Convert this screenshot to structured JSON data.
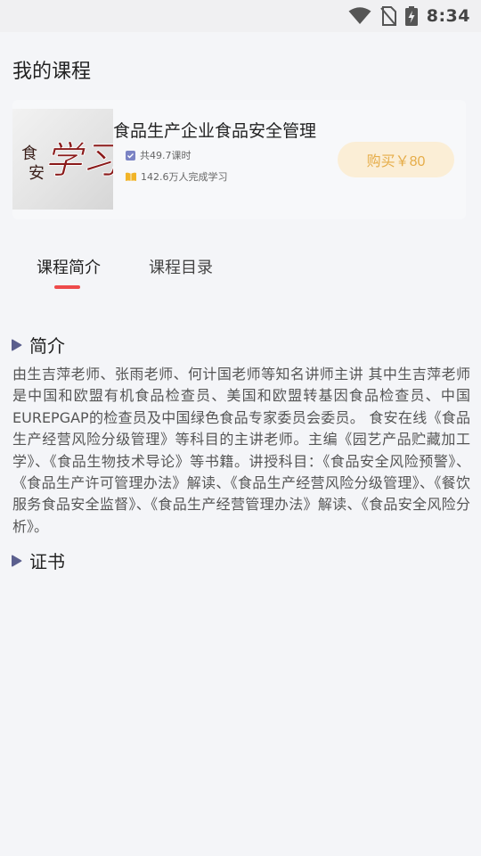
{
  "status_bar": {
    "time": "8:34",
    "icons": [
      "wifi-icon",
      "no-sim-icon",
      "battery-charging-icon"
    ]
  },
  "page": {
    "title": "我的课程"
  },
  "course": {
    "thumbnail_text": "食安学习",
    "name": "食品生产企业食品安全管理",
    "hours": "共49.7课时",
    "learners": "142.6万人完成学习",
    "buy_label": "购买￥80"
  },
  "tabs": [
    {
      "label": "课程简介",
      "active": true
    },
    {
      "label": "课程目录",
      "active": false
    }
  ],
  "intro": {
    "heading": "简介",
    "body": "由生吉萍老师、张雨老师、何计国老师等知名讲师主讲 其中生吉萍老师是中国和欧盟有机食品检查员、美国和欧盟转基因食品检查员、中国EUREPGAP的检查员及中国绿色食品专家委员会委员。 食安在线《食品生产经营风险分级管理》等科目的主讲老师。主编《园艺产品贮藏加工学》、《食品生物技术导论》等书籍。讲授科目：《食品安全风险预警》、《食品生产许可管理办法》解读、《食品生产经营风险分级管理》、《餐饮服务食品安全监督》、《食品生产经营管理办法》解读、《食品安全风险分析》。"
  },
  "certificate": {
    "heading": "证书"
  },
  "colors": {
    "accent_red": "#ee4b4b",
    "buy_bg": "#fbeed6",
    "buy_text": "#e6ad4a",
    "section_marker": "#5b5f8e"
  }
}
